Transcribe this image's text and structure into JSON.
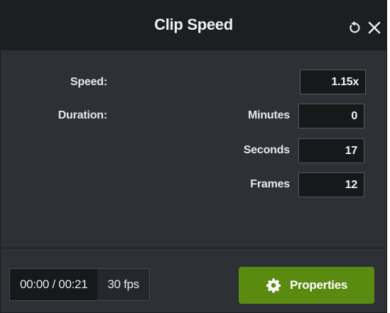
{
  "dialog": {
    "title": "Clip Speed",
    "reset_icon": "reset-icon",
    "close_icon": "close-icon"
  },
  "speed": {
    "label": "Speed:",
    "value": "1.15x"
  },
  "duration": {
    "label": "Duration:",
    "minutes_label": "Minutes",
    "minutes_value": "0",
    "seconds_label": "Seconds",
    "seconds_value": "17",
    "frames_label": "Frames",
    "frames_value": "12"
  },
  "footer": {
    "time_readout": "00:00 / 00:21",
    "fps": "30 fps",
    "properties_label": "Properties",
    "properties_icon": "gear-icon",
    "accent_color": "#5a8a10"
  }
}
